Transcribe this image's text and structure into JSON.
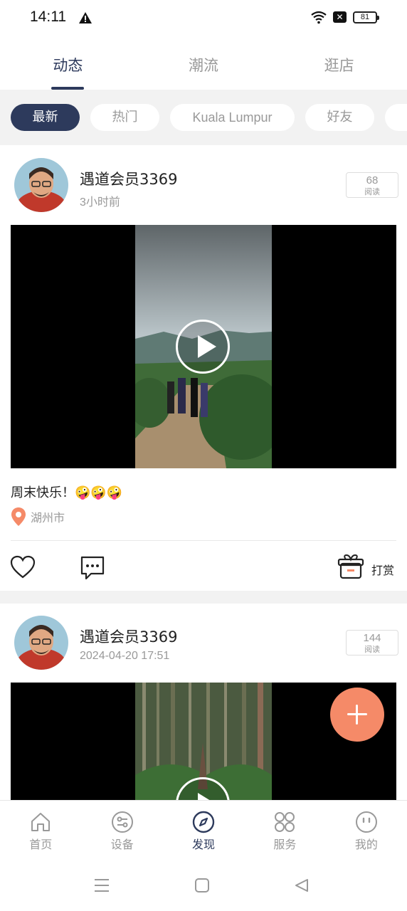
{
  "status": {
    "time": "14:11",
    "battery": "81"
  },
  "top_tabs": [
    {
      "label": "动态",
      "active": true
    },
    {
      "label": "潮流",
      "active": false
    },
    {
      "label": "逛店",
      "active": false
    }
  ],
  "filters": [
    {
      "label": "最新",
      "active": true
    },
    {
      "label": "热门",
      "active": false
    },
    {
      "label": "Kuala Lumpur",
      "active": false
    },
    {
      "label": "好友",
      "active": false
    }
  ],
  "posts": [
    {
      "username": "遇道会员3369",
      "time": "3小时前",
      "read_count": "68",
      "read_label": "阅读",
      "caption": "周末快乐！🤪🤪🤪",
      "location": "湖州市",
      "reward_label": "打赏"
    },
    {
      "username": "遇道会员3369",
      "time": "2024-04-20 17:51",
      "read_count": "144",
      "read_label": "阅读"
    }
  ],
  "bottom_nav": [
    {
      "label": "首页",
      "icon": "home-icon",
      "active": false
    },
    {
      "label": "设备",
      "icon": "device-icon",
      "active": false
    },
    {
      "label": "发现",
      "icon": "compass-icon",
      "active": true
    },
    {
      "label": "服务",
      "icon": "service-icon",
      "active": false
    },
    {
      "label": "我的",
      "icon": "smiley-icon",
      "active": false
    }
  ],
  "colors": {
    "accent": "#2d3a5c",
    "fab": "#f58a68",
    "location_pin": "#f58a68"
  }
}
